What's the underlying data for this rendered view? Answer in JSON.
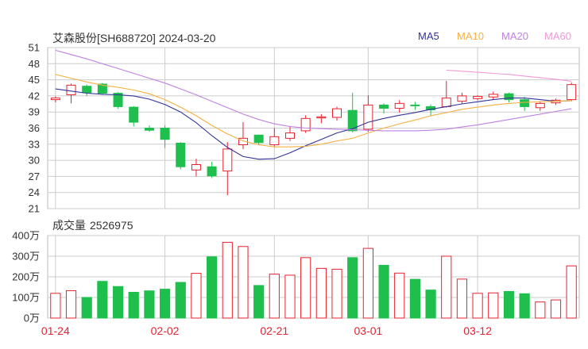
{
  "header": {
    "title": "艾森股份[SH688720] 2024-03-20",
    "legend": [
      {
        "label": "MA5",
        "color": "#333399"
      },
      {
        "label": "MA10",
        "color": "#f5b041"
      },
      {
        "label": "MA20",
        "color": "#c080e0"
      },
      {
        "label": "MA60",
        "color": "#f09ad8"
      }
    ]
  },
  "volume_header": {
    "label": "成交量",
    "value": "2526975"
  },
  "colors": {
    "up": "#e8212e",
    "down": "#1fbf4e",
    "grid": "#cccccc",
    "axis_text": "#333333",
    "date_text": "#e8212e"
  },
  "chart_data": [
    {
      "type": "candlestick",
      "title": "艾森股份[SH688720] 2024-03-20",
      "ylim": [
        21,
        51
      ],
      "yticks": [
        21,
        24,
        27,
        30,
        33,
        36,
        39,
        42,
        45,
        48,
        51
      ],
      "xtick_labels": [
        {
          "index": 0,
          "label": "01-24"
        },
        {
          "index": 7,
          "label": "02-02"
        },
        {
          "index": 14,
          "label": "02-21"
        },
        {
          "index": 20,
          "label": "03-01"
        },
        {
          "index": 27,
          "label": "03-12"
        }
      ],
      "candles": [
        {
          "o": 41.3,
          "c": 41.6,
          "h": 41.9,
          "l": 40.8
        },
        {
          "o": 42.2,
          "c": 44.0,
          "h": 44.3,
          "l": 40.6
        },
        {
          "o": 43.8,
          "c": 42.6,
          "h": 44.1,
          "l": 42.0
        },
        {
          "o": 44.2,
          "c": 42.5,
          "h": 44.4,
          "l": 42.3
        },
        {
          "o": 42.5,
          "c": 40.0,
          "h": 42.7,
          "l": 39.6
        },
        {
          "o": 39.9,
          "c": 37.1,
          "h": 40.1,
          "l": 36.3
        },
        {
          "o": 36.0,
          "c": 35.6,
          "h": 36.5,
          "l": 35.3
        },
        {
          "o": 36.0,
          "c": 33.9,
          "h": 36.5,
          "l": 32.3
        },
        {
          "o": 33.2,
          "c": 28.8,
          "h": 33.4,
          "l": 28.3
        },
        {
          "o": 28.2,
          "c": 29.2,
          "h": 30.3,
          "l": 27.0
        },
        {
          "o": 28.8,
          "c": 27.1,
          "h": 29.7,
          "l": 26.7
        },
        {
          "o": 28.0,
          "c": 32.1,
          "h": 33.4,
          "l": 23.5
        },
        {
          "o": 32.9,
          "c": 34.1,
          "h": 37.1,
          "l": 32.1
        },
        {
          "o": 34.7,
          "c": 33.3,
          "h": 34.8,
          "l": 32.9
        },
        {
          "o": 32.9,
          "c": 34.4,
          "h": 36.0,
          "l": 32.5
        },
        {
          "o": 34.1,
          "c": 35.1,
          "h": 36.4,
          "l": 33.6
        },
        {
          "o": 35.5,
          "c": 37.8,
          "h": 38.4,
          "l": 35.1
        },
        {
          "o": 37.9,
          "c": 38.1,
          "h": 38.6,
          "l": 36.9
        },
        {
          "o": 38.0,
          "c": 39.6,
          "h": 40.0,
          "l": 37.4
        },
        {
          "o": 39.3,
          "c": 35.5,
          "h": 42.6,
          "l": 35.2
        },
        {
          "o": 35.8,
          "c": 40.3,
          "h": 42.1,
          "l": 35.3
        },
        {
          "o": 40.3,
          "c": 39.7,
          "h": 40.6,
          "l": 38.7
        },
        {
          "o": 39.7,
          "c": 40.6,
          "h": 41.2,
          "l": 38.9
        },
        {
          "o": 40.3,
          "c": 40.2,
          "h": 40.9,
          "l": 39.4
        },
        {
          "o": 40.0,
          "c": 39.4,
          "h": 40.4,
          "l": 38.2
        },
        {
          "o": 40.0,
          "c": 41.6,
          "h": 44.8,
          "l": 39.8
        },
        {
          "o": 41.0,
          "c": 42.0,
          "h": 42.6,
          "l": 40.5
        },
        {
          "o": 41.5,
          "c": 41.9,
          "h": 42.1,
          "l": 41.2
        },
        {
          "o": 41.8,
          "c": 42.3,
          "h": 42.8,
          "l": 41.3
        },
        {
          "o": 42.4,
          "c": 41.3,
          "h": 42.6,
          "l": 40.8
        },
        {
          "o": 41.3,
          "c": 40.0,
          "h": 41.8,
          "l": 39.2
        },
        {
          "o": 39.8,
          "c": 40.6,
          "h": 41.0,
          "l": 39.2
        },
        {
          "o": 40.7,
          "c": 41.2,
          "h": 41.5,
          "l": 40.3
        },
        {
          "o": 41.3,
          "c": 44.1,
          "h": 44.5,
          "l": 41.0
        }
      ],
      "ma": [
        {
          "name": "MA5",
          "color": "#333399",
          "values": [
            43.3,
            42.9,
            42.5,
            42.3,
            42.2,
            42.0,
            41.4,
            40.4,
            39.0,
            37.0,
            34.6,
            32.4,
            30.7,
            30.2,
            30.3,
            31.4,
            32.7,
            33.9,
            35.1,
            35.9,
            37.1,
            37.8,
            38.4,
            38.9,
            39.5,
            40.0,
            40.5,
            40.9,
            41.3,
            41.6,
            41.6,
            41.3,
            41.0,
            41.1
          ]
        },
        {
          "name": "MA10",
          "color": "#f5b041",
          "values": [
            46.0,
            45.3,
            44.6,
            44.0,
            43.6,
            43.1,
            42.4,
            41.3,
            39.9,
            38.3,
            36.5,
            34.9,
            33.6,
            32.9,
            32.5,
            32.5,
            32.6,
            33.0,
            33.6,
            34.1,
            35.1,
            36.0,
            36.8,
            37.5,
            38.3,
            38.9,
            39.5,
            39.9,
            40.3,
            40.6,
            40.8,
            40.9,
            41.0,
            41.1
          ]
        },
        {
          "name": "MA20",
          "color": "#c080e0",
          "values": [
            50.5,
            49.7,
            48.9,
            48.0,
            47.1,
            46.2,
            45.3,
            44.4,
            43.3,
            42.2,
            41.0,
            39.8,
            38.6,
            37.6,
            36.8,
            36.3,
            36.0,
            35.9,
            35.8,
            35.7,
            35.6,
            35.5,
            35.5,
            35.5,
            35.6,
            35.8,
            36.2,
            36.6,
            37.1,
            37.6,
            38.1,
            38.6,
            39.1,
            39.6
          ]
        },
        {
          "name": "MA60",
          "color": "#f09ad8",
          "start_index": 25,
          "values": [
            46.8,
            46.6,
            46.4,
            46.2,
            46.0,
            45.7,
            45.4,
            45.1,
            44.7
          ]
        }
      ]
    },
    {
      "type": "bar",
      "title": "成交量",
      "unit": "万",
      "ylim": [
        0,
        400
      ],
      "yticks": [
        0,
        100,
        200,
        300,
        400
      ],
      "ytick_labels": [
        "0万",
        "100万",
        "200万",
        "300万",
        "400万"
      ],
      "values": [
        120,
        133,
        100,
        178,
        153,
        125,
        132,
        140,
        173,
        217,
        297,
        367,
        347,
        158,
        213,
        208,
        293,
        241,
        237,
        293,
        338,
        256,
        218,
        188,
        136,
        300,
        189,
        120,
        122,
        129,
        118,
        78,
        88,
        253
      ]
    }
  ]
}
